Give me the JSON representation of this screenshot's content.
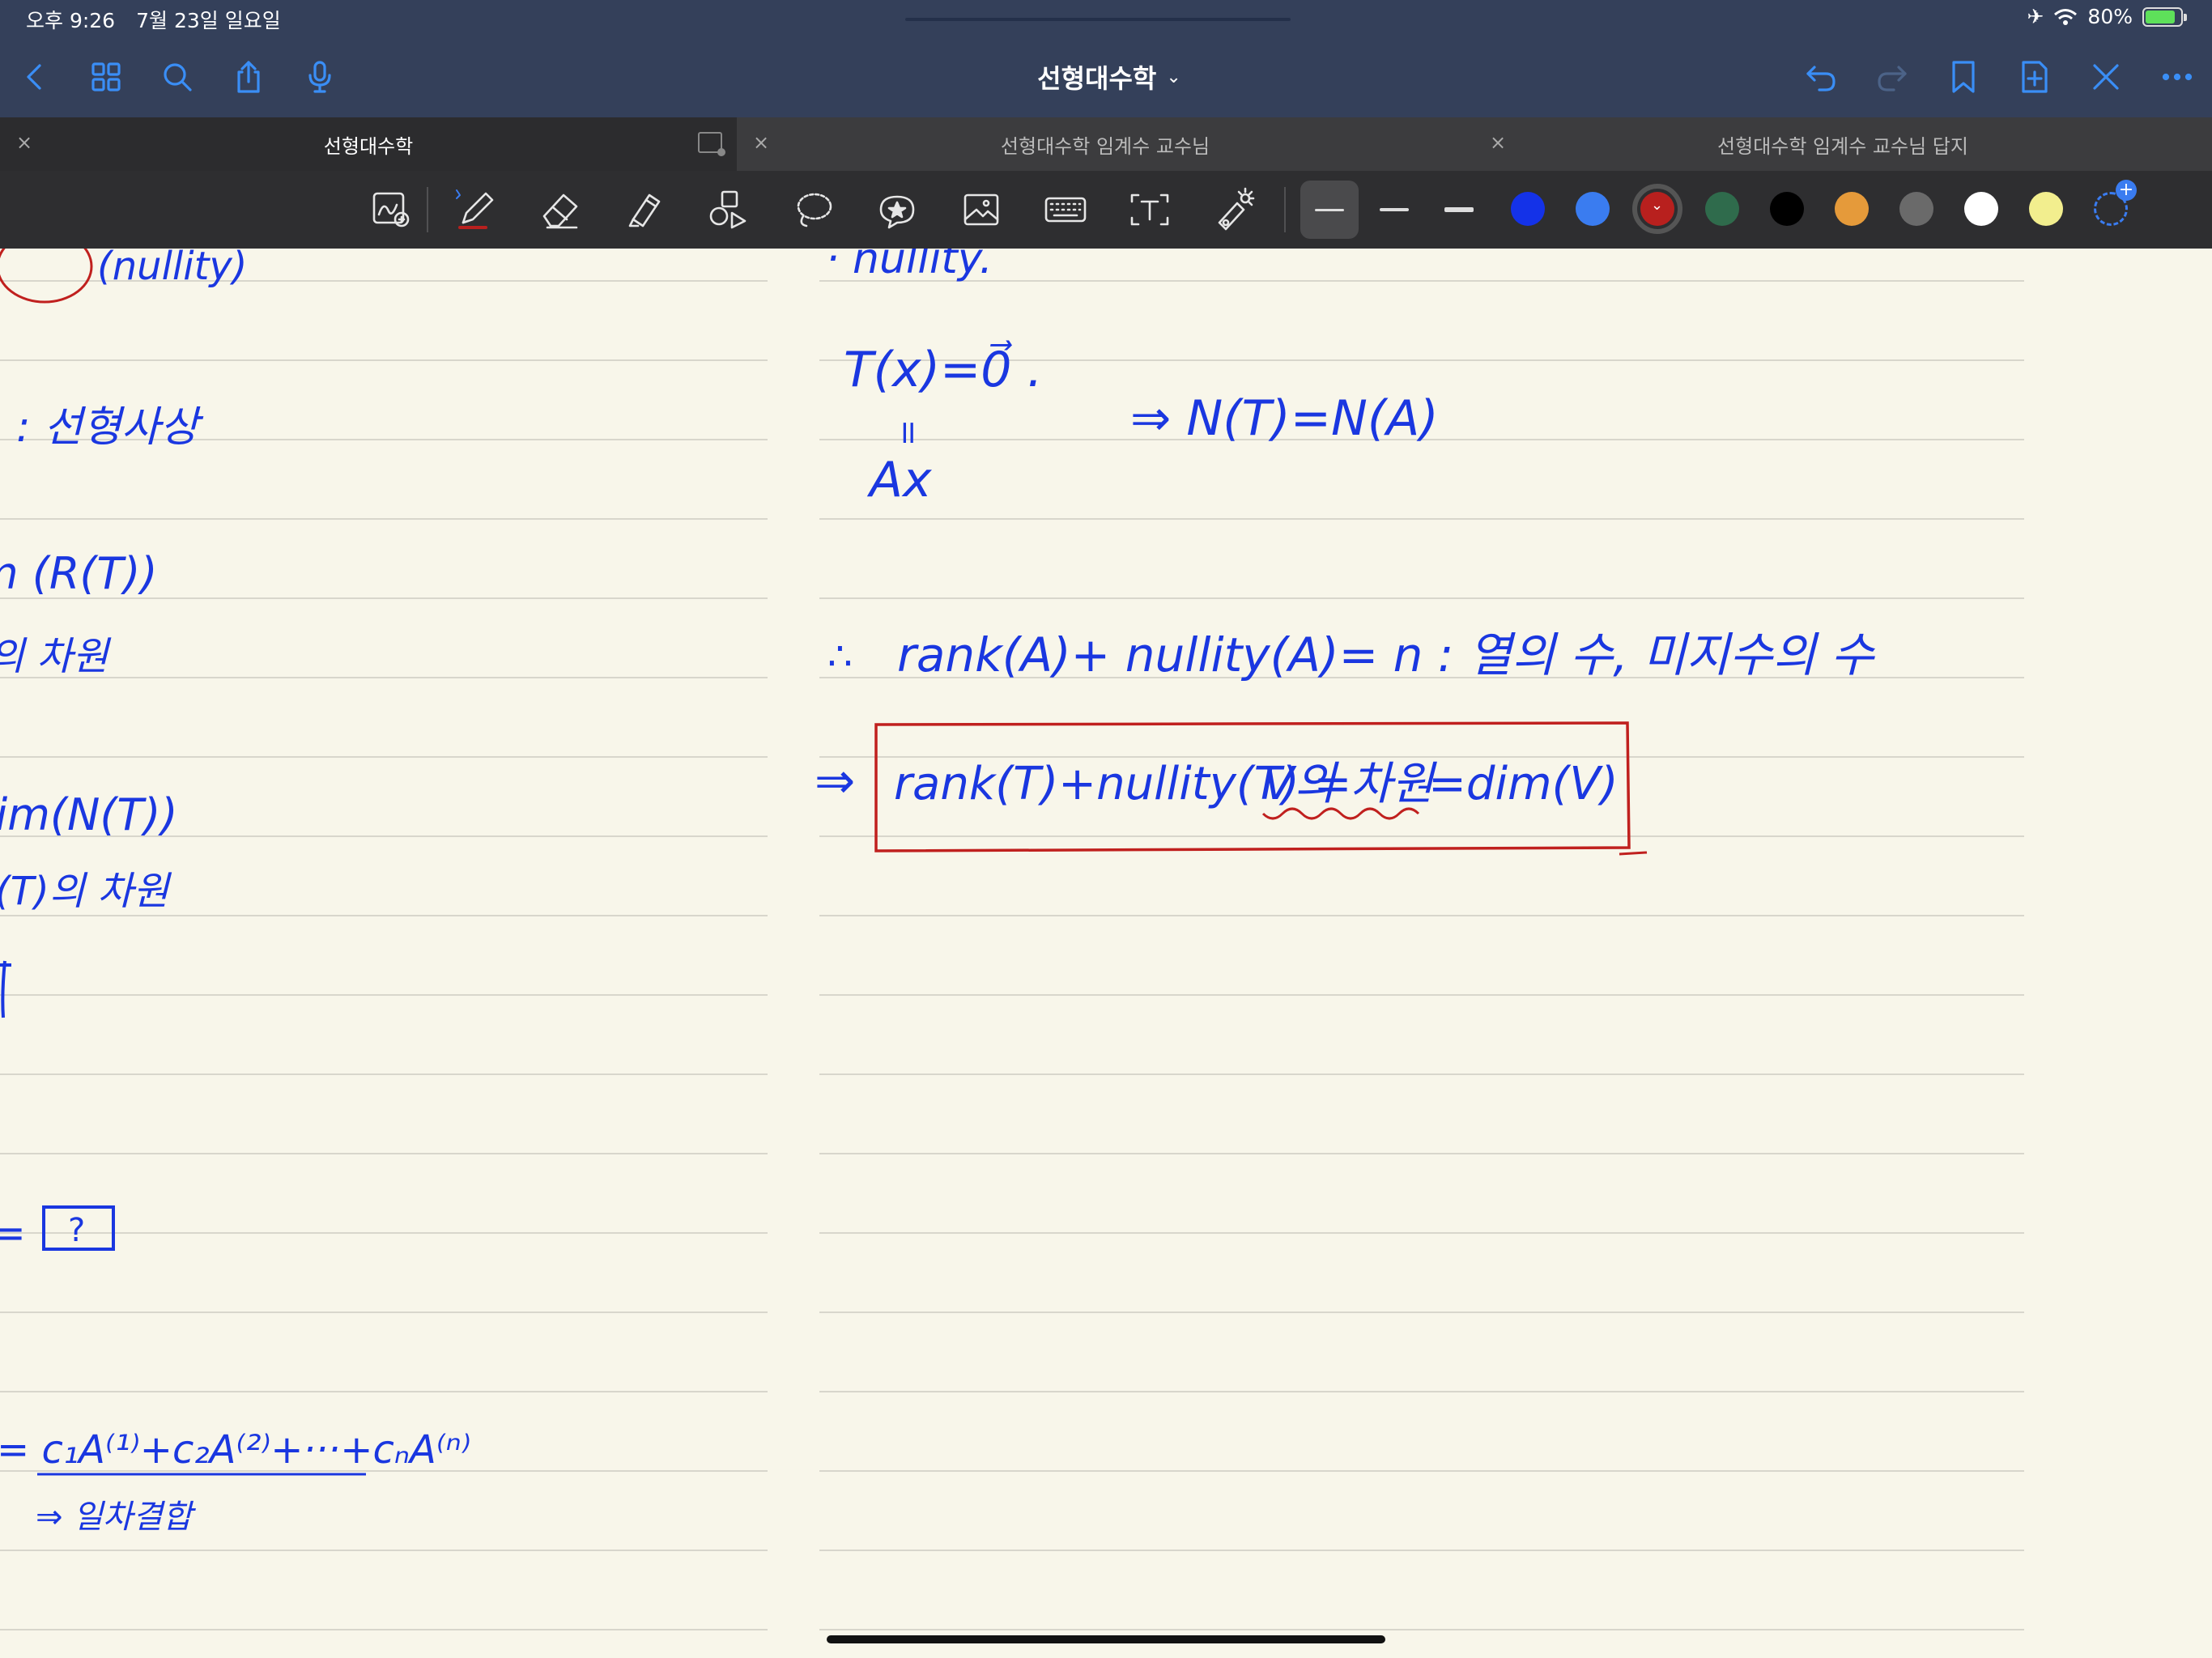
{
  "status_bar": {
    "time": "오후 9:26",
    "date": "7월 23일 일요일",
    "battery": "80%"
  },
  "nav": {
    "title": "선형대수학",
    "title_chevron": "⌄"
  },
  "tabs": [
    {
      "label": "선형대수학",
      "active": true
    },
    {
      "label": "선형대수학 임계수 교수님",
      "active": false
    },
    {
      "label": "선형대수학 임계수 교수님 답지",
      "active": false
    }
  ],
  "tab_close_glyph": "×",
  "toolbar": {
    "tools": [
      "zoom-window-icon",
      "pen-icon",
      "eraser-icon",
      "highlighter-icon",
      "shapes-icon",
      "lasso-icon",
      "elements-icon",
      "image-icon",
      "keyboard-icon",
      "text-icon",
      "laser-pointer-icon"
    ],
    "colors": [
      "#1432e8",
      "#3a7cf0",
      "#b8201e",
      "#2f6b4c",
      "#000000",
      "#e59a3a",
      "#6a6a6a",
      "#ffffff",
      "#f2ee8e"
    ],
    "selected_color": "#b8201e"
  },
  "left_page_ink": {
    "line1": "(nullity)",
    "line2": ": 선형사상",
    "line3": "m (R(T))",
    "line4": "의 차원",
    "line5": "dim(N(T))",
    "line6": "(T)의 차원",
    "line7": "=",
    "line7_box": "?",
    "line8": "= c₁A⁽¹⁾+c₂A⁽²⁾+···+cₙA⁽ⁿ⁾",
    "line9": "⇒ 일차결합"
  },
  "right_page_ink": {
    "heading": "· nullity.",
    "eq1": "T(x)=0⃗ .",
    "eq1_equals": "॥",
    "eq1_ax": "Ax",
    "implication": "⇒ N(T)=N(A)",
    "therefore": "∴",
    "theorem": "rank(A)+ nullity(A)= n : 열의 수, 미지수의 수",
    "arrow": "⇒",
    "boxed_part1": "rank(T)+nullity(T) =",
    "boxed_part2": "V의 차원",
    "boxed_part3": "=dim(V)"
  }
}
